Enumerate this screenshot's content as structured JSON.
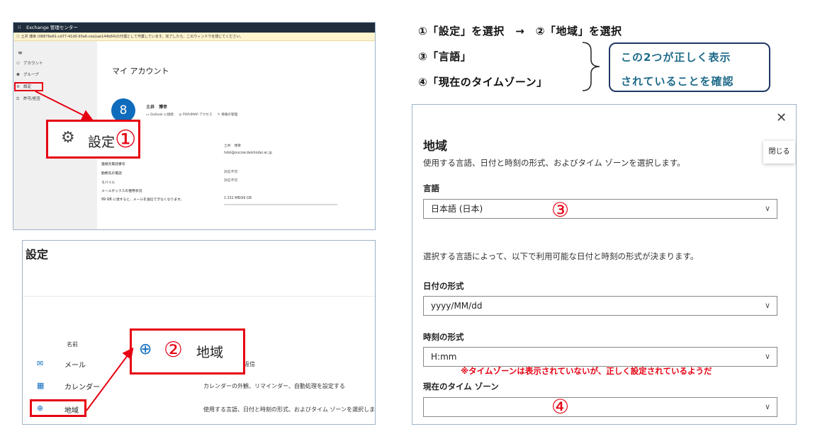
{
  "panelA": {
    "app_title": "Exchange 管理センター",
    "banner_text": "ⓘ 土井 博幸 (08876e61-cd77-41d0-93e6-cea1ae144b64)の代理として作業しています。完了したら、このウィンドウを閉じてください。",
    "sidebar_items": [
      {
        "label": "アカウント",
        "icon": "person-icon"
      },
      {
        "label": "グループ",
        "icon": "group-icon"
      },
      {
        "label": "設定",
        "icon": "gear-icon"
      },
      {
        "label": "許可/拒否",
        "icon": "permission-icon"
      }
    ],
    "page_title": "マイ アカウント",
    "avatar_initial": "8",
    "user_name": "土井　博幸",
    "links": [
      "Outlook に接続",
      "POP/IMAP アクセス",
      "情報の管理"
    ],
    "info_rows": [
      {
        "label": "",
        "value": "土井　博幸"
      },
      {
        "label": "",
        "value": "hdoi@oucow.daishodai.ac.jp"
      },
      {
        "label": "連絡先電話番号",
        "value": ""
      },
      {
        "label": "勤務先の電話",
        "value": "対応不可"
      },
      {
        "label": "モバイル",
        "value": "対応不可"
      },
      {
        "label": "メールボックスの使用状況",
        "value": ""
      },
      {
        "label": "99 GB に達すると、メールを送信できなくなります。",
        "value": "1.332 MB/99 GB"
      }
    ],
    "zoom_label": "設定",
    "zoom_number": "①"
  },
  "panelB": {
    "title": "設定",
    "column_header": "名前",
    "rows": [
      {
        "label": "メール",
        "icon": "mail-icon",
        "desc": "返信"
      },
      {
        "label": "カレンダー",
        "icon": "calendar-icon",
        "desc": "カレンダーの外観、リマインダー、自動処理を設定する"
      },
      {
        "label": "地域",
        "icon": "globe-icon",
        "desc": "使用する言語、日付と時刻の形式、およびタイム ゾーンを選択します。"
      }
    ],
    "zoom_number": "②",
    "zoom_label": "地域"
  },
  "instructions": {
    "line1": "①「設定」を選択　→　②「地域」を選択",
    "line3": "③「言語」",
    "line4": "④「現在のタイムゾーン」",
    "note_line1": "この2つが正しく表示",
    "note_line2": "されていることを確認"
  },
  "panelC": {
    "close_tooltip": "閉じる",
    "heading": "地域",
    "subtitle": "使用する言語、日付と時刻の形式、およびタイム ゾーンを選択します。",
    "language_label": "言語",
    "language_value": "日本語 (日本)",
    "language_marker": "③",
    "format_note": "選択する言語によって、以下で利用可能な日付と時刻の形式が決まります。",
    "date_format_label": "日付の形式",
    "date_format_value": "yyyy/MM/dd",
    "time_format_label": "時刻の形式",
    "time_format_value": "H:mm",
    "timezone_note": "※タイムゾーンは表示されていないが、正しく設定されているようだ",
    "timezone_label": "現在のタイム ゾーン",
    "timezone_value": "",
    "timezone_marker": "④"
  },
  "colors": {
    "accent_red": "#e60012",
    "brand_blue": "#0f6cbd",
    "header_dark": "#1f2d3d",
    "note_text": "#1f6b8a"
  }
}
